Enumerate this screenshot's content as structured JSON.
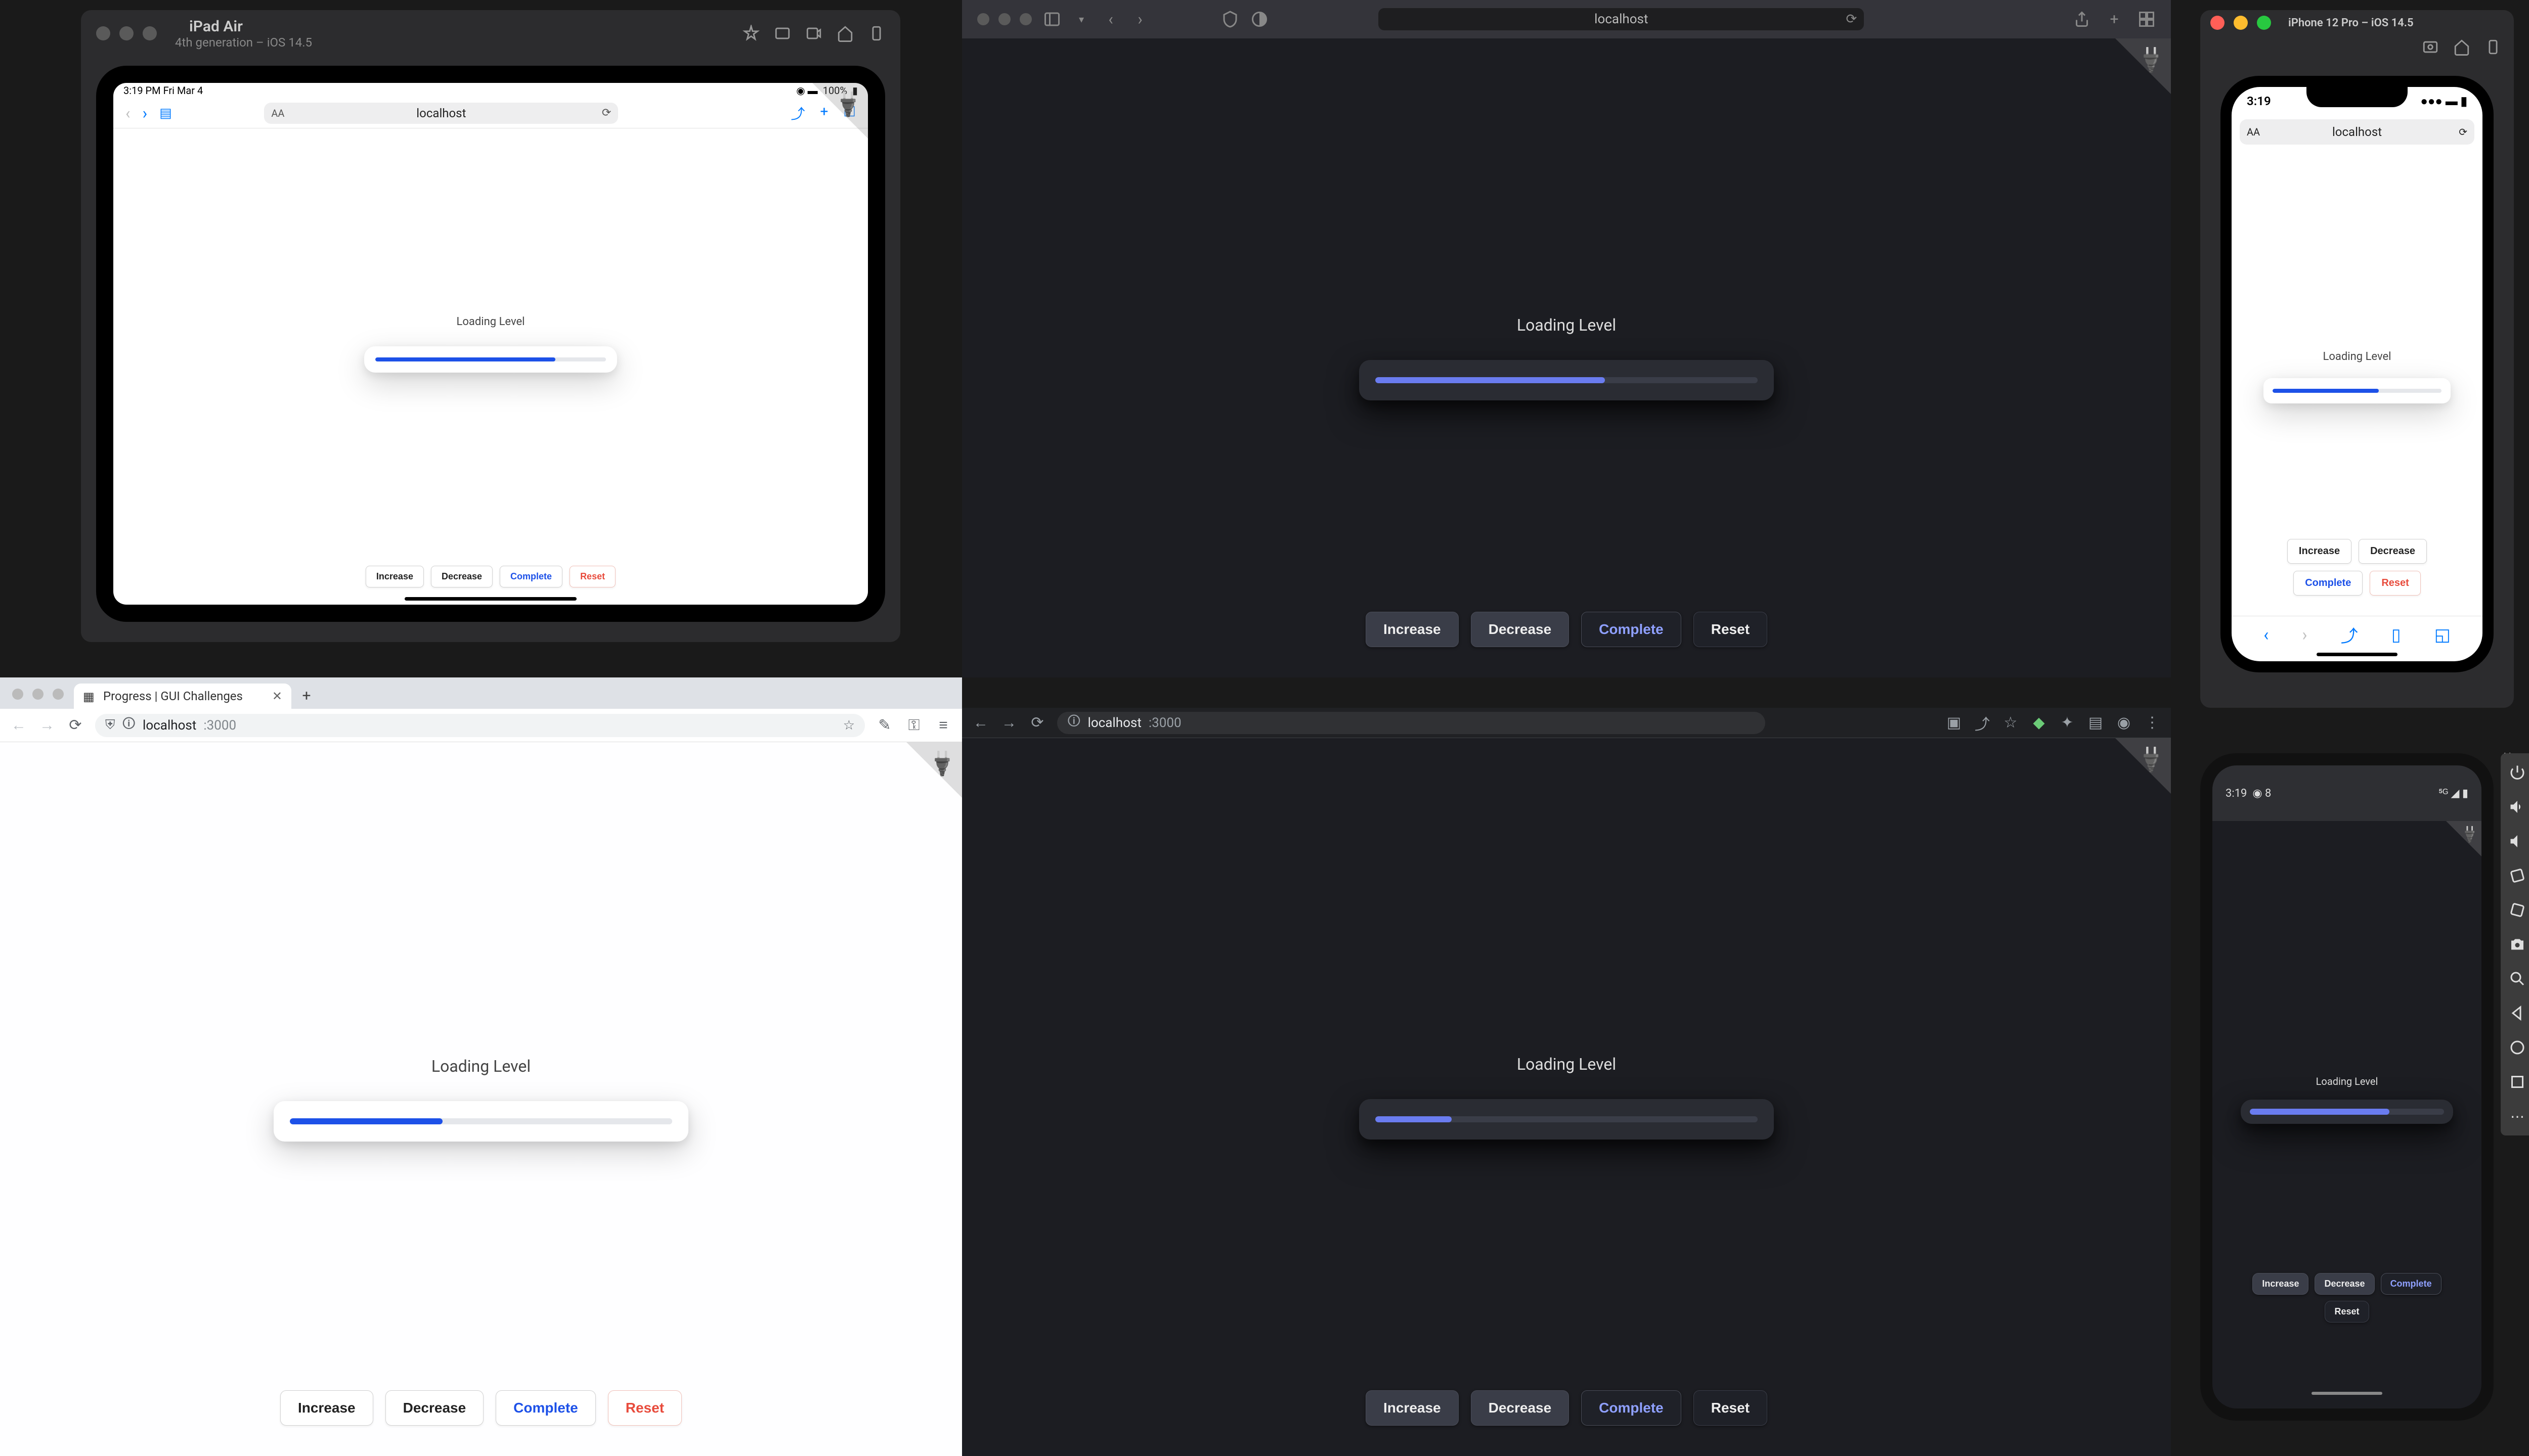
{
  "app": {
    "loading_label": "Loading Level",
    "buttons": {
      "increase": "Increase",
      "decrease": "Decrease",
      "complete": "Complete",
      "reset": "Reset"
    }
  },
  "progress": {
    "ipad_pct": 78,
    "safari_mac_pct": 60,
    "iphone_pct": 63,
    "chrome_light_pct": 40,
    "chrome_dark_pct": 20,
    "android_pct": 72
  },
  "ipad_sim": {
    "title": "iPad Air",
    "subtitle": "4th generation – iOS 14.5",
    "status_time": "3:19 PM   Fri Mar 4",
    "status_right": "100%",
    "url": "localhost"
  },
  "safari_mac": {
    "url": "localhost"
  },
  "iphone_sim": {
    "title": "iPhone 12 Pro – iOS 14.5",
    "status_time": "3:19",
    "url": "localhost"
  },
  "chrome_light": {
    "tab_title": "Progress | GUI Challenges",
    "url_host": "localhost",
    "url_port": ":3000"
  },
  "chrome_dark": {
    "url_host": "localhost",
    "url_port": ":3000"
  },
  "android": {
    "status_time": "3:19",
    "status_temp": "8"
  },
  "colors": {
    "accent_light": "#1d51e8",
    "accent_dark": "#6a7cf0",
    "danger": "#e84b3c"
  }
}
